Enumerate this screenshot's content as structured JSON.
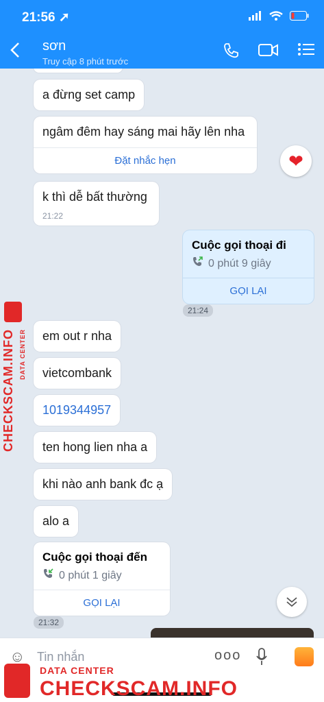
{
  "status_bar": {
    "time": "21:56 ➚"
  },
  "header": {
    "back_icon": "chevron-left-icon",
    "contact_name": "sơn",
    "last_seen": "Truy cập 8 phút trước"
  },
  "messages": {
    "m1": "a đừng set camp",
    "m2": "ngâm đêm hay sáng mai hãy lên nha",
    "m2_action": "Đặt nhắc hẹn",
    "m3": "k thì dễ bất thường",
    "m3_time": "21:22",
    "out_call_title": "Cuộc gọi thoại đi",
    "out_call_duration": "0 phút 9 giây",
    "out_call_redial": "GỌI LẠI",
    "out_call_time": "21:24",
    "m4": "em out r nha",
    "m5": "vietcombank",
    "m6": "1019344957",
    "m7": "ten hong lien nha a",
    "m8": "khi nào anh bank đc ạ",
    "m9": "alo a",
    "in_call_title": "Cuộc gọi thoại đến",
    "in_call_duration": "0 phút 1 giây",
    "in_call_redial": "GỌI LẠI",
    "in_call_time": "21:32"
  },
  "composer": {
    "placeholder": "Tin nhắn"
  },
  "watermark": {
    "line1": "DATA CENTER",
    "line2": "CHECKSCAM.INFO"
  },
  "colors": {
    "accent": "#1e90ff",
    "chat_bg": "#e2e9f1",
    "link": "#2b6fd6",
    "outgoing": "#dff0ff",
    "watermark": "#e12828"
  }
}
